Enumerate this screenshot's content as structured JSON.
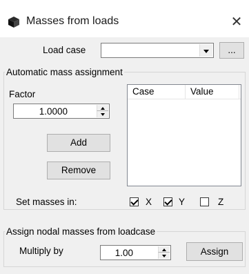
{
  "window": {
    "title": "Masses from loads",
    "close_glyph": "✕",
    "icon": "cube-icon"
  },
  "load_case": {
    "label": "Load case",
    "value": "",
    "browse_label": "..."
  },
  "automatic": {
    "legend": "Automatic mass assignment",
    "factor_label": "Factor",
    "factor_value": "1.0000",
    "add_label": "Add",
    "remove_label": "Remove",
    "table": {
      "columns": [
        "Case",
        "Value"
      ],
      "rows": []
    },
    "set_masses_label": "Set masses in:",
    "axes": [
      {
        "label": "X",
        "checked": true
      },
      {
        "label": "Y",
        "checked": true
      },
      {
        "label": "Z",
        "checked": false
      }
    ]
  },
  "nodal": {
    "legend": "Assign nodal masses from loadcase",
    "multiply_label": "Multiply by",
    "multiply_value": "1.00",
    "assign_label": "Assign"
  }
}
